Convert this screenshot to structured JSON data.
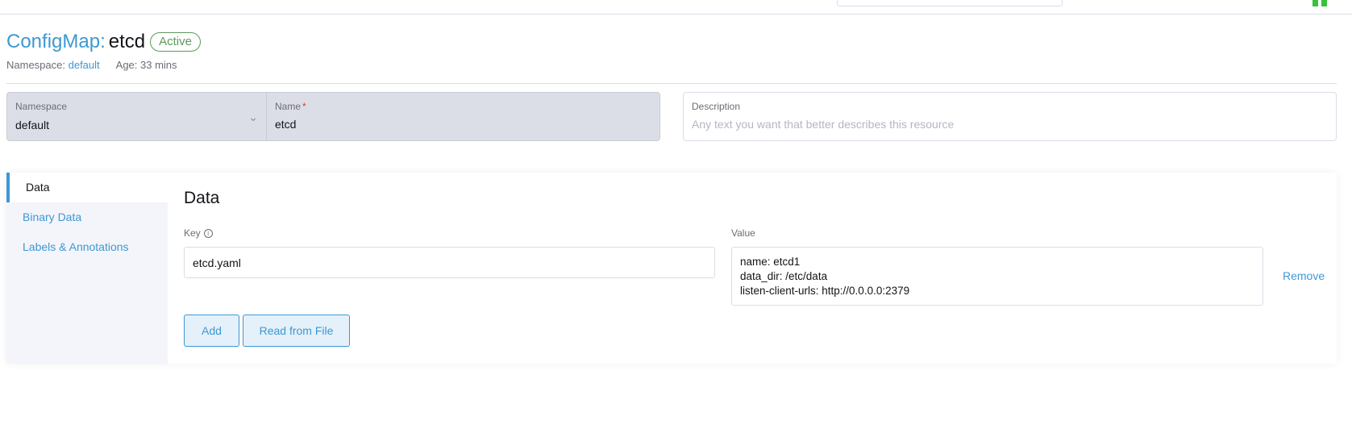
{
  "header": {
    "resource_type": "ConfigMap:",
    "resource_name": "etcd",
    "state": "Active",
    "namespace_label": "Namespace:",
    "namespace_value": "default",
    "age_text": "Age: 33 mins"
  },
  "form": {
    "namespace_label": "Namespace",
    "namespace_value": "default",
    "name_label": "Name",
    "name_required_marker": "*",
    "name_value": "etcd",
    "description_label": "Description",
    "description_placeholder": "Any text you want that better describes this resource"
  },
  "tabs": [
    {
      "label": "Data",
      "active": true
    },
    {
      "label": "Binary Data",
      "active": false
    },
    {
      "label": "Labels & Annotations",
      "active": false
    }
  ],
  "data_tab": {
    "title": "Data",
    "key_header": "Key",
    "value_header": "Value",
    "rows": [
      {
        "key": "etcd.yaml",
        "value_lines": [
          "name: etcd1",
          "data_dir: /etc/data",
          "listen-client-urls: http://0.0.0.0:2379"
        ],
        "remove_label": "Remove"
      }
    ],
    "add_label": "Add",
    "read_from_file_label": "Read from File"
  },
  "icons": {
    "info": "info-icon",
    "chevron": "chevron-down-icon"
  },
  "colors": {
    "accent": "#3d98d3",
    "active_badge": "#5d995d",
    "status_green": "#38c23d"
  }
}
